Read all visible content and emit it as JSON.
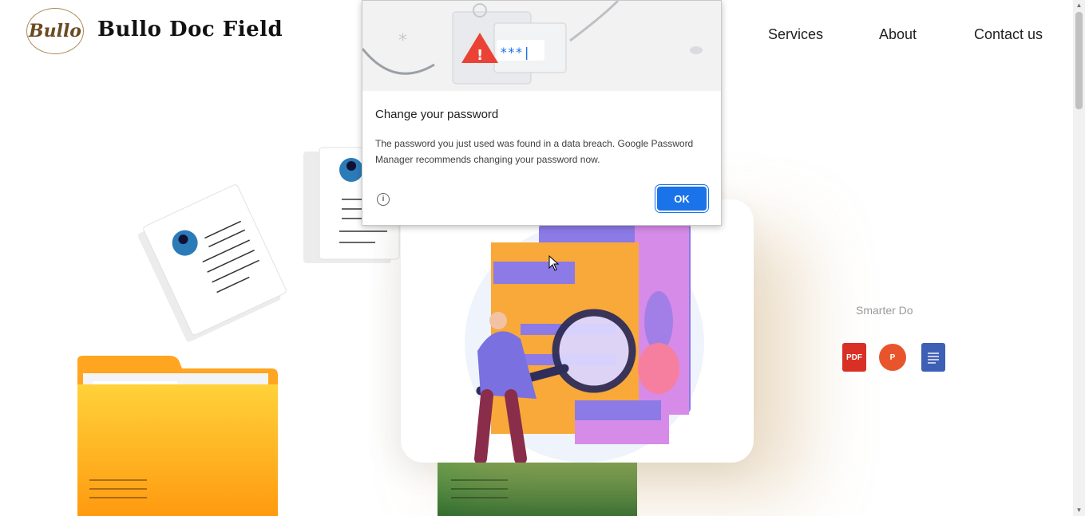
{
  "header": {
    "logo_text": "Bullo",
    "brand_name": "Bullo Doc Field",
    "nav": [
      {
        "label": "Services"
      },
      {
        "label": "About"
      },
      {
        "label": "Contact us"
      }
    ]
  },
  "hero": {
    "tagline": "Smarter Do",
    "file_icons": [
      "pdf-icon",
      "powerpoint-icon",
      "word-doc-icon"
    ],
    "pdf_label": "PDF",
    "ppt_label": "P"
  },
  "dialog": {
    "title": "Change your password",
    "body": "The password you just used was found in a data breach. Google Password Manager recommends changing your password now.",
    "ok_label": "OK",
    "masked_password": "***|"
  },
  "colors": {
    "accent_blue": "#1a73e8",
    "folder_orange": "#ffa51f",
    "brand_brown": "#b08a5a"
  }
}
